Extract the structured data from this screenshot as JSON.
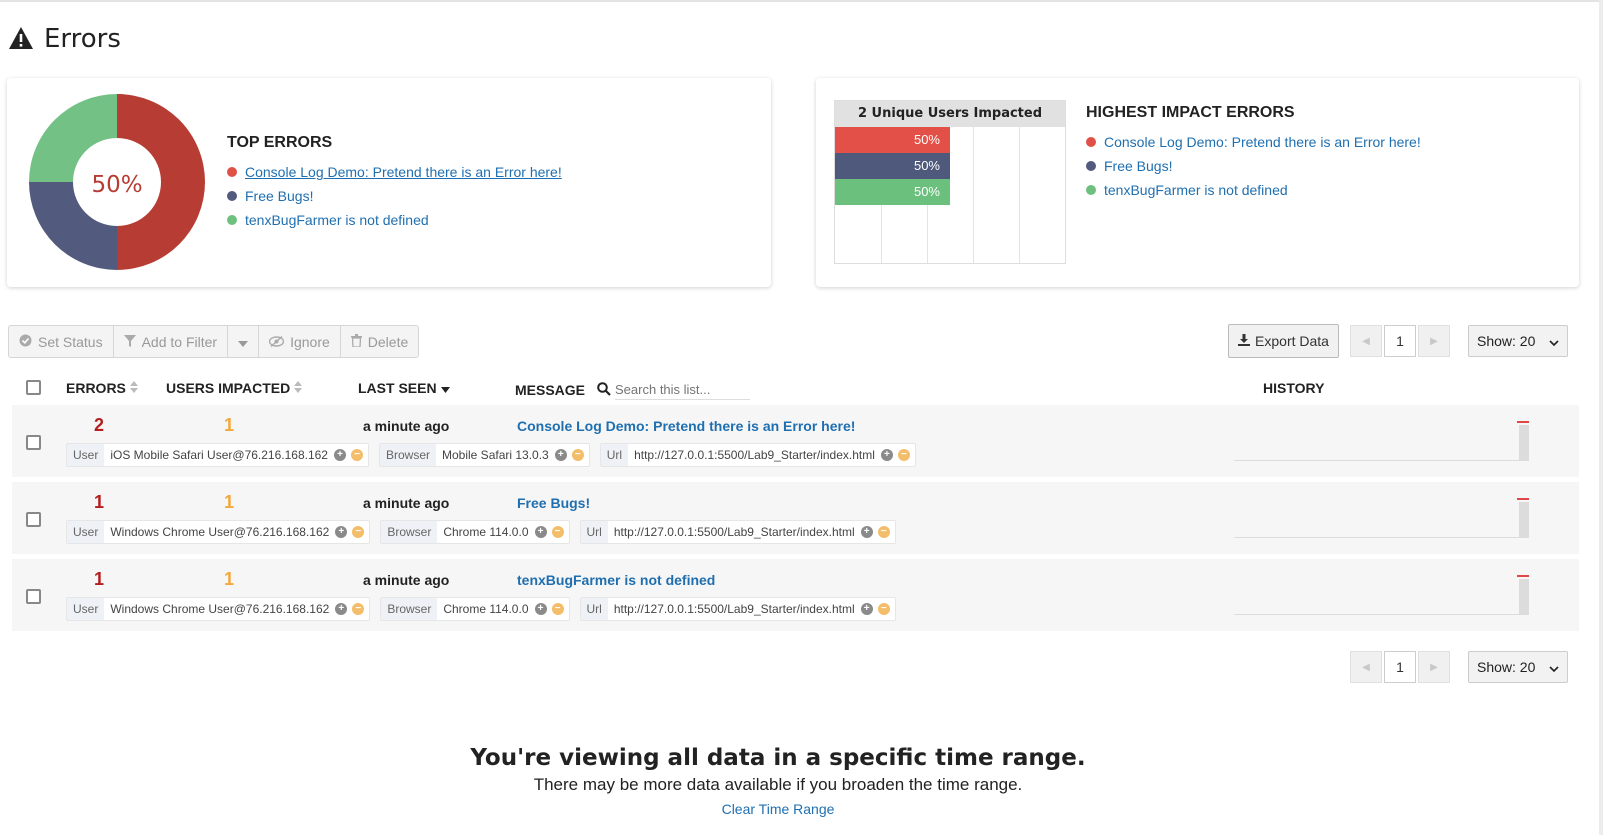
{
  "page": {
    "title": "Errors"
  },
  "top_errors": {
    "title": "TOP ERRORS",
    "center_label": "50%",
    "items": [
      {
        "label": "Console Log Demo: Pretend there is an Error here!",
        "color": "#e05047"
      },
      {
        "label": "Free Bugs!",
        "color": "#525b7d"
      },
      {
        "label": "tenxBugFarmer is not defined",
        "color": "#6dc07e"
      }
    ]
  },
  "chart_data": [
    {
      "type": "pie",
      "title": "TOP ERRORS",
      "categories": [
        "Console Log Demo: Pretend there is an Error here!",
        "Free Bugs!",
        "tenxBugFarmer is not defined"
      ],
      "values": [
        50,
        25,
        25
      ],
      "colors": [
        "#b73c33",
        "#525b7d",
        "#74c186"
      ],
      "center_label": "50%"
    },
    {
      "type": "bar",
      "title": "2 Unique Users Impacted",
      "categories": [
        "Console Log Demo: Pretend there is an Error here!",
        "Free Bugs!",
        "tenxBugFarmer is not defined"
      ],
      "values": [
        50,
        50,
        50
      ],
      "value_labels": [
        "50%",
        "50%",
        "50%"
      ],
      "colors": [
        "#e35048",
        "#4f597c",
        "#6cc07e"
      ],
      "xlim": [
        0,
        100
      ]
    }
  ],
  "impact": {
    "header": "2 Unique Users Impacted",
    "title": "HIGHEST IMPACT ERRORS",
    "items": [
      {
        "label": "Console Log Demo: Pretend there is an Error here!",
        "color": "#e05047"
      },
      {
        "label": "Free Bugs!",
        "color": "#525b7d"
      },
      {
        "label": "tenxBugFarmer is not defined",
        "color": "#6dc07e"
      }
    ]
  },
  "toolbar": {
    "set_status": "Set Status",
    "add_to_filter": "Add to Filter",
    "ignore": "Ignore",
    "delete": "Delete",
    "export": "Export Data"
  },
  "pager": {
    "page": "1",
    "show": "Show: 20"
  },
  "table": {
    "headers": {
      "errors": "ERRORS",
      "users": "USERS IMPACTED",
      "last_seen": "LAST SEEN",
      "message": "MESSAGE",
      "history": "HISTORY"
    },
    "search_placeholder": "Search this list...",
    "rows": [
      {
        "errors": "2",
        "users": "1",
        "last_seen": "a minute ago",
        "message": "Console Log Demo: Pretend there is an Error here!",
        "tags": [
          [
            "User",
            "iOS Mobile Safari User@76.216.168.162"
          ],
          [
            "Browser",
            "Mobile Safari 13.0.3"
          ],
          [
            "Url",
            "http://127.0.0.1:5500/Lab9_Starter/index.html"
          ]
        ]
      },
      {
        "errors": "1",
        "users": "1",
        "last_seen": "a minute ago",
        "message": "Free Bugs!",
        "tags": [
          [
            "User",
            "Windows Chrome User@76.216.168.162"
          ],
          [
            "Browser",
            "Chrome 114.0.0"
          ],
          [
            "Url",
            "http://127.0.0.1:5500/Lab9_Starter/index.html"
          ]
        ]
      },
      {
        "errors": "1",
        "users": "1",
        "last_seen": "a minute ago",
        "message": "tenxBugFarmer is not defined",
        "tags": [
          [
            "User",
            "Windows Chrome User@76.216.168.162"
          ],
          [
            "Browser",
            "Chrome 114.0.0"
          ],
          [
            "Url",
            "http://127.0.0.1:5500/Lab9_Starter/index.html"
          ]
        ]
      }
    ]
  },
  "footer": {
    "heading": "You're viewing all data in a specific time range.",
    "sub": "There may be more data available if you broaden the time range.",
    "link": "Clear Time Range"
  }
}
